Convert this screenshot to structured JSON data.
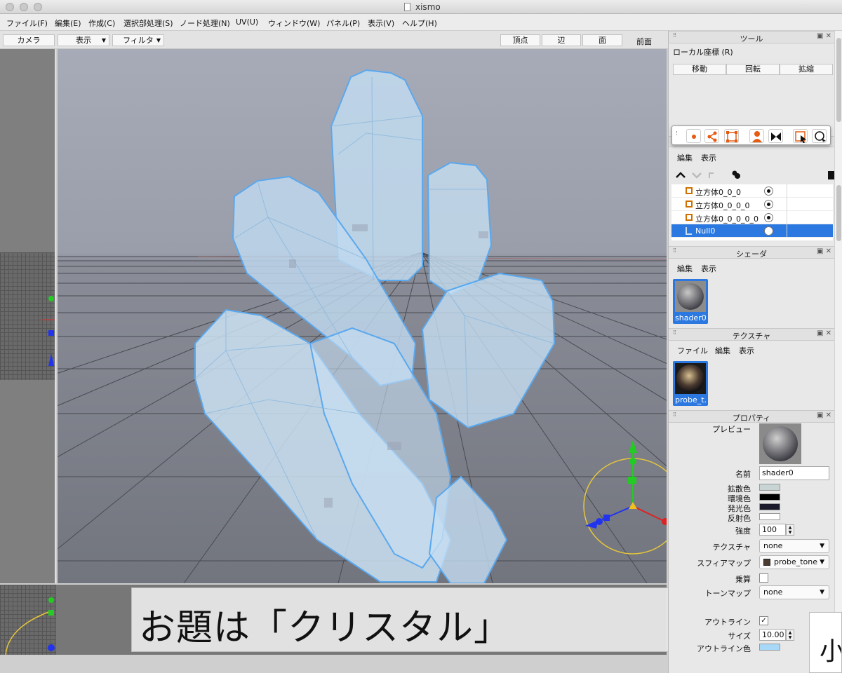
{
  "window": {
    "title": "xismo"
  },
  "menubar": [
    "ファイル(F)",
    "編集(E)",
    "作成(C)",
    "選択部処理(S)",
    "ノード処理(N)",
    "UV(U)",
    "ウィンドウ(W)",
    "パネル(P)",
    "表示(V)",
    "ヘルプ(H)"
  ],
  "view_toolbar": {
    "camera": "カメラ",
    "display": "表示",
    "filter": "フィルタ",
    "vertex": "頂点",
    "edge": "辺",
    "face": "面",
    "view_name": "前面"
  },
  "tool_panel": {
    "title": "ツール",
    "coord": "ローカル座標 (R)",
    "move": "移動",
    "rotate": "回転",
    "scale": "拡縮"
  },
  "scene_panel": {
    "menu_edit": "編集",
    "menu_view": "表示",
    "items": [
      {
        "name": "立方体0_0_0",
        "selected": false
      },
      {
        "name": "立方体0_0_0_0",
        "selected": false
      },
      {
        "name": "立方体0_0_0_0_0",
        "selected": false
      },
      {
        "name": "Null0",
        "selected": true
      }
    ]
  },
  "shader_panel": {
    "title": "シェーダ",
    "menu_edit": "編集",
    "menu_view": "表示",
    "thumb_label": "shader0"
  },
  "texture_panel": {
    "title": "テクスチャ",
    "menu_file": "ファイル",
    "menu_edit": "編集",
    "menu_view": "表示",
    "thumb_label": "probe_t…"
  },
  "property_panel": {
    "title": "プロパティ",
    "preview_label": "プレビュー",
    "name_label": "名前",
    "name_value": "shader0",
    "diffuse_label": "拡散色",
    "ambient_label": "環境色",
    "emissive_label": "発光色",
    "reflect_label": "反射色",
    "strength_label": "強度",
    "strength_value": "100",
    "texture_label": "テクスチャ",
    "texture_value": "none",
    "sphere_label": "スフィアマップ",
    "sphere_value": "probe_tone",
    "multiply_label": "乗算",
    "toon_label": "トーンマップ",
    "toon_value": "none",
    "outline_label": "アウトライン",
    "size_label": "サイズ",
    "size_value": "10.00",
    "outline_color_label": "アウトライン色",
    "colors": {
      "diffuse": "#c8d4d4",
      "ambient": "#000000",
      "emissive": "#1a1a2a",
      "reflect": "#ffffff",
      "outline": "#a8d8f8"
    }
  },
  "caption": "お題は「クリスタル」",
  "corner_glyph": "小"
}
